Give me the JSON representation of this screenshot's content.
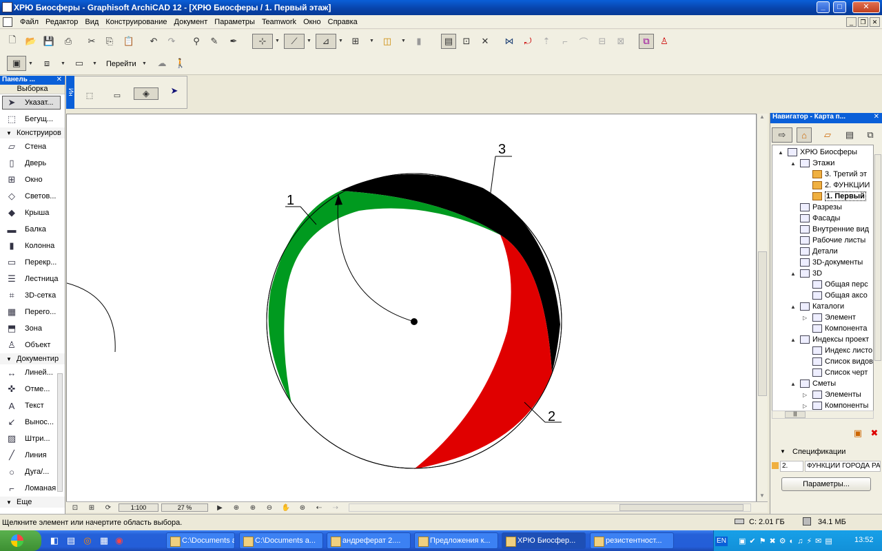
{
  "window": {
    "title": "ХРЮ Биосферы - Graphisoft ArchiCAD 12 - [ХРЮ Биосферы / 1. Первый этаж]"
  },
  "menu": [
    "Файл",
    "Редактор",
    "Вид",
    "Конструирование",
    "Документ",
    "Параметры",
    "Teamwork",
    "Окно",
    "Справка"
  ],
  "toolbar2": {
    "goto_label": "Перейти"
  },
  "toolbox": {
    "title": "Панель ...",
    "selection_label": "Выборка",
    "pointer": "Указат...",
    "marquee": "Бегущ...",
    "section_construct": "Конструиров",
    "construct_items": [
      {
        "label": "Стена",
        "icon": "wall-icon"
      },
      {
        "label": "Дверь",
        "icon": "door-icon"
      },
      {
        "label": "Окно",
        "icon": "window-icon"
      },
      {
        "label": "Светов...",
        "icon": "skylight-icon"
      },
      {
        "label": "Крыша",
        "icon": "roof-icon"
      },
      {
        "label": "Балка",
        "icon": "beam-icon"
      },
      {
        "label": "Колонна",
        "icon": "column-icon"
      },
      {
        "label": "Перекр...",
        "icon": "slab-icon"
      },
      {
        "label": "Лестница",
        "icon": "stair-icon"
      },
      {
        "label": "3D-сетка",
        "icon": "mesh-icon"
      },
      {
        "label": "Перего...",
        "icon": "curtain-wall-icon"
      },
      {
        "label": "Зона",
        "icon": "zone-icon"
      },
      {
        "label": "Объект",
        "icon": "object-icon"
      }
    ],
    "section_document": "Документир",
    "document_items": [
      {
        "label": "Линей...",
        "icon": "dimension-icon"
      },
      {
        "label": "Отме...",
        "icon": "level-dimension-icon"
      },
      {
        "label": "Текст",
        "icon": "text-icon"
      },
      {
        "label": "Выноc...",
        "icon": "label-icon"
      },
      {
        "label": "Штри...",
        "icon": "fill-icon"
      },
      {
        "label": "Линия",
        "icon": "line-icon"
      },
      {
        "label": "Дуга/...",
        "icon": "arc-icon"
      },
      {
        "label": "Ломаная",
        "icon": "polyline-icon"
      }
    ],
    "more": "Еще"
  },
  "infobox": {
    "tab_label": "Ин"
  },
  "drawing": {
    "labels": [
      "1",
      "2",
      "3"
    ],
    "colors": {
      "green": "#009a1f",
      "red": "#e00000",
      "black": "#000000"
    }
  },
  "bottombar": {
    "scale": "1:100",
    "zoom": "27 %"
  },
  "navigator": {
    "title": "Навигатор - Карта п...",
    "tree": [
      {
        "label": "ХРЮ Биосферы",
        "level": 0,
        "exp": "▲"
      },
      {
        "label": "Этажи",
        "level": 1,
        "exp": "▲"
      },
      {
        "label": "3. Третий эт",
        "level": 2,
        "folder": true
      },
      {
        "label": "2. ФУНКЦИИ",
        "level": 2,
        "folder": true
      },
      {
        "label": "1. Первый",
        "level": 2,
        "folder": true,
        "selected": true
      },
      {
        "label": "Разрезы",
        "level": 1
      },
      {
        "label": "Фасады",
        "level": 1
      },
      {
        "label": "Внутренние вид",
        "level": 1
      },
      {
        "label": "Рабочие листы",
        "level": 1
      },
      {
        "label": "Детали",
        "level": 1
      },
      {
        "label": "3D-документы",
        "level": 1
      },
      {
        "label": "3D",
        "level": 1,
        "exp": "▲"
      },
      {
        "label": "Общая перс",
        "level": 2
      },
      {
        "label": "Общая аксо",
        "level": 2
      },
      {
        "label": "Каталоги",
        "level": 1,
        "exp": "▲"
      },
      {
        "label": "Элемент",
        "level": 2,
        "exp": "▷"
      },
      {
        "label": "Компонента",
        "level": 2
      },
      {
        "label": "Индексы проект",
        "level": 1,
        "exp": "▲"
      },
      {
        "label": "Индекс листо",
        "level": 2
      },
      {
        "label": "Список видов",
        "level": 2
      },
      {
        "label": "Список черт",
        "level": 2
      },
      {
        "label": "Сметы",
        "level": 1,
        "exp": "▲"
      },
      {
        "label": "Элементы",
        "level": 2,
        "exp": "▷"
      },
      {
        "label": "Компоненты",
        "level": 2,
        "exp": "▷"
      }
    ],
    "specs_label": "Спецификации",
    "spec_num": "2.",
    "spec_value": "ФУНКЦИИ ГОРОДА РА",
    "params_button": "Параметры..."
  },
  "statusbar": {
    "hint": "Щелкните элемент или начертите область выбора.",
    "disk": "C: 2.01 ГБ",
    "memory": "34.1 МБ"
  },
  "taskbar": {
    "buttons": [
      "C:\\Documents a...",
      "C:\\Documents a...",
      "андреферат 2....",
      "Предложения к...",
      "ХРЮ Биосфер...",
      "резистентност..."
    ],
    "active_index": 4,
    "lang": "EN",
    "clock": "13:52"
  }
}
